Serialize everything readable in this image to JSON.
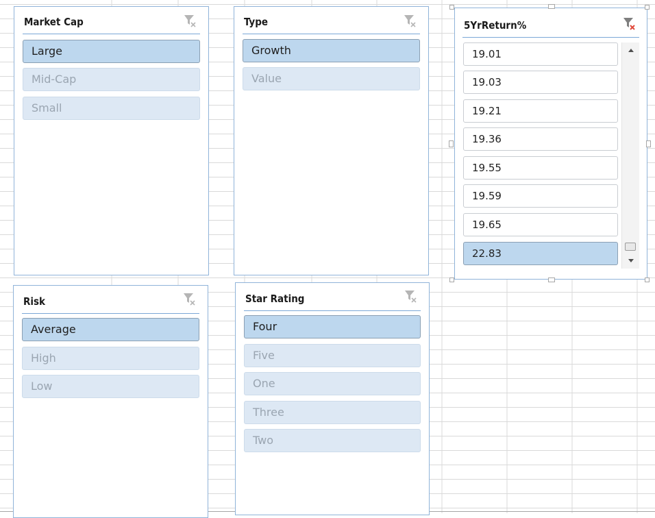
{
  "slicers": {
    "market_cap": {
      "title": "Market Cap",
      "items": [
        {
          "label": "Large",
          "state": "selected"
        },
        {
          "label": "Mid-Cap",
          "state": "unselected"
        },
        {
          "label": "Small",
          "state": "unselected"
        }
      ]
    },
    "type": {
      "title": "Type",
      "items": [
        {
          "label": "Growth",
          "state": "selected"
        },
        {
          "label": "Value",
          "state": "unselected"
        }
      ]
    },
    "five_yr_return": {
      "title": "5YrReturn%",
      "items": [
        {
          "label": "19.01",
          "state": "plain"
        },
        {
          "label": "19.03",
          "state": "plain"
        },
        {
          "label": "19.21",
          "state": "plain"
        },
        {
          "label": "19.36",
          "state": "plain"
        },
        {
          "label": "19.55",
          "state": "plain"
        },
        {
          "label": "19.59",
          "state": "plain"
        },
        {
          "label": "19.65",
          "state": "plain"
        },
        {
          "label": "22.83",
          "state": "selected"
        }
      ],
      "scroll_position": 1.0,
      "filter_active": true
    },
    "risk": {
      "title": "Risk",
      "items": [
        {
          "label": "Average",
          "state": "selected"
        },
        {
          "label": "High",
          "state": "unselected"
        },
        {
          "label": "Low",
          "state": "unselected"
        }
      ]
    },
    "star_rating": {
      "title": "Star Rating",
      "items": [
        {
          "label": "Four",
          "state": "selected"
        },
        {
          "label": "Five",
          "state": "unselected"
        },
        {
          "label": "One",
          "state": "unselected"
        },
        {
          "label": "Three",
          "state": "unselected"
        },
        {
          "label": "Two",
          "state": "unselected"
        }
      ]
    }
  },
  "colors": {
    "selected_item": "#bdd7ee",
    "unselected_item": "#dde8f4",
    "slicer_border": "#8fb3d9",
    "gridline": "#d9d9d9",
    "clear_filter_active": "#e0493a"
  },
  "icons": {
    "clear_filter": "clear-filter-icon",
    "scroll_up": "scroll-up-arrow-icon",
    "scroll_down": "scroll-down-arrow-icon"
  }
}
